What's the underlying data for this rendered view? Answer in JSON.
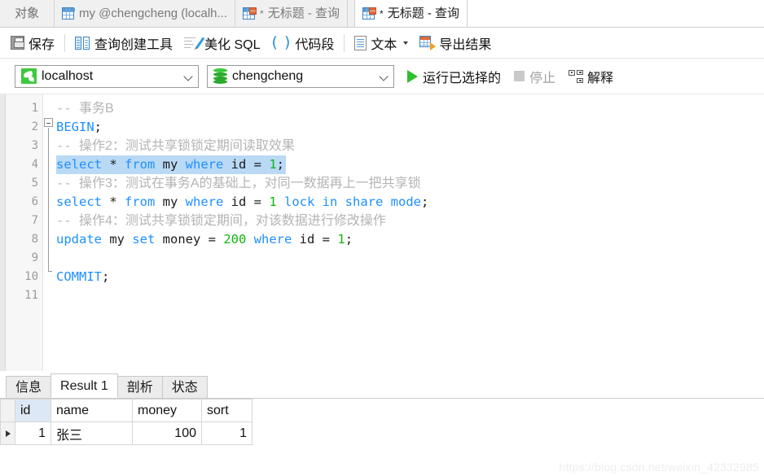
{
  "tabbar": {
    "object_tab": "对象",
    "tabs": [
      {
        "label": "my @chengcheng (localh...",
        "icon": "grid-icon",
        "active": false,
        "modified": false
      },
      {
        "label": "无标题 - 查询",
        "icon": "query-grid-icon",
        "active": false,
        "modified": true,
        "star": "*"
      },
      {
        "label": "无标题 - 查询",
        "icon": "query-grid-icon",
        "active": true,
        "modified": true,
        "star": "*"
      }
    ]
  },
  "toolbar": {
    "save_label": "保存",
    "query_builder_label": "查询创建工具",
    "beautify_label": "美化 SQL",
    "snippet_label": "代码段",
    "text_label": "文本",
    "export_label": "导出结果"
  },
  "connection": {
    "host_value": "localhost",
    "database_value": "chengcheng",
    "run_selected_label": "运行已选择的",
    "stop_label": "停止",
    "explain_label": "解释"
  },
  "editor": {
    "line_numbers": [
      "1",
      "2",
      "3",
      "4",
      "5",
      "6",
      "7",
      "8",
      "9",
      "10",
      "11"
    ],
    "lines": [
      {
        "n": 1,
        "type": "comment",
        "text": "-- 事务B"
      },
      {
        "n": 2,
        "type": "code",
        "text": "BEGIN;",
        "fold_start": true
      },
      {
        "n": 3,
        "type": "comment",
        "text": "-- 操作2：测试共享锁锁定期间读取效果"
      },
      {
        "n": 4,
        "type": "code",
        "text": "select * from my where id = 1;",
        "selected": true
      },
      {
        "n": 5,
        "type": "comment",
        "text": "-- 操作3：测试在事务A的基础上，对同一数据再上一把共享锁"
      },
      {
        "n": 6,
        "type": "code",
        "text": "select * from my where id = 1 lock in share mode;"
      },
      {
        "n": 7,
        "type": "comment",
        "text": "-- 操作4：测试共享锁锁定期间，对该数据进行修改操作"
      },
      {
        "n": 8,
        "type": "code",
        "text": "update my set money = 200 where id = 1;"
      },
      {
        "n": 9,
        "type": "blank",
        "text": ""
      },
      {
        "n": 10,
        "type": "code",
        "text": "COMMIT;",
        "fold_end": true
      },
      {
        "n": 11,
        "type": "blank",
        "text": ""
      }
    ],
    "tokens": {
      "l2": [
        {
          "t": "BEGIN",
          "c": "k"
        },
        {
          "t": ";",
          "c": "op"
        }
      ],
      "l4": [
        {
          "t": "select",
          "c": "k"
        },
        {
          "t": " ",
          "c": "op"
        },
        {
          "t": "*",
          "c": "op"
        },
        {
          "t": " ",
          "c": "op"
        },
        {
          "t": "from",
          "c": "k"
        },
        {
          "t": " ",
          "c": "op"
        },
        {
          "t": "my",
          "c": "id"
        },
        {
          "t": " ",
          "c": "op"
        },
        {
          "t": "where",
          "c": "k"
        },
        {
          "t": " ",
          "c": "op"
        },
        {
          "t": "id",
          "c": "id"
        },
        {
          "t": " = ",
          "c": "op"
        },
        {
          "t": "1",
          "c": "num"
        },
        {
          "t": ";",
          "c": "op"
        }
      ],
      "l6": [
        {
          "t": "select",
          "c": "k"
        },
        {
          "t": " ",
          "c": "op"
        },
        {
          "t": "*",
          "c": "op"
        },
        {
          "t": " ",
          "c": "op"
        },
        {
          "t": "from",
          "c": "k"
        },
        {
          "t": " ",
          "c": "op"
        },
        {
          "t": "my",
          "c": "id"
        },
        {
          "t": " ",
          "c": "op"
        },
        {
          "t": "where",
          "c": "k"
        },
        {
          "t": " ",
          "c": "op"
        },
        {
          "t": "id",
          "c": "id"
        },
        {
          "t": " = ",
          "c": "op"
        },
        {
          "t": "1",
          "c": "num"
        },
        {
          "t": " ",
          "c": "op"
        },
        {
          "t": "lock",
          "c": "k"
        },
        {
          "t": " ",
          "c": "op"
        },
        {
          "t": "in",
          "c": "k"
        },
        {
          "t": " ",
          "c": "op"
        },
        {
          "t": "share",
          "c": "k"
        },
        {
          "t": " ",
          "c": "op"
        },
        {
          "t": "mode",
          "c": "k"
        },
        {
          "t": ";",
          "c": "op"
        }
      ],
      "l8": [
        {
          "t": "update",
          "c": "k"
        },
        {
          "t": " ",
          "c": "op"
        },
        {
          "t": "my",
          "c": "id"
        },
        {
          "t": " ",
          "c": "op"
        },
        {
          "t": "set",
          "c": "k"
        },
        {
          "t": " ",
          "c": "op"
        },
        {
          "t": "money",
          "c": "id"
        },
        {
          "t": " = ",
          "c": "op"
        },
        {
          "t": "200",
          "c": "num"
        },
        {
          "t": " ",
          "c": "op"
        },
        {
          "t": "where",
          "c": "k"
        },
        {
          "t": " ",
          "c": "op"
        },
        {
          "t": "id",
          "c": "id"
        },
        {
          "t": " = ",
          "c": "op"
        },
        {
          "t": "1",
          "c": "num"
        },
        {
          "t": ";",
          "c": "op"
        }
      ],
      "l10": [
        {
          "t": "COMMIT",
          "c": "k"
        },
        {
          "t": ";",
          "c": "op"
        }
      ]
    },
    "colors": {
      "keyword": "#1e90ff",
      "number": "#12b512",
      "identifier": "#1b1b1b",
      "comment": "#b4b4b4",
      "selection": "#b9d9f5"
    }
  },
  "results": {
    "tabs": [
      {
        "label": "信息",
        "active": false
      },
      {
        "label": "Result 1",
        "active": true
      },
      {
        "label": "剖析",
        "active": false
      },
      {
        "label": "状态",
        "active": false
      }
    ],
    "grid": {
      "columns": [
        "id",
        "name",
        "money",
        "sort"
      ],
      "selected_column": "id",
      "rows": [
        {
          "id": "1",
          "name": "张三",
          "money": "100",
          "sort": "1",
          "current": true
        }
      ]
    }
  },
  "watermark": "https://blog.csdn.net/weixin_42332985"
}
